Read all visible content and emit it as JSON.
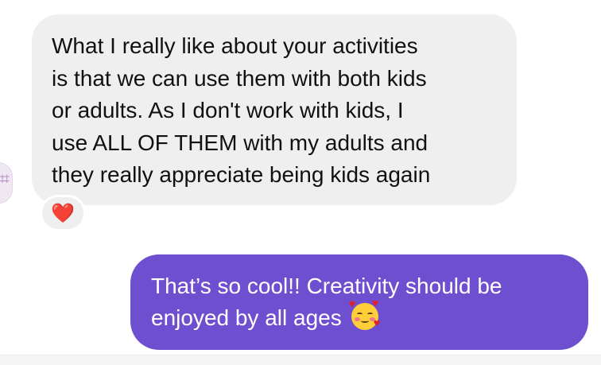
{
  "incoming_message": {
    "lines": [
      "What I really like about your activities",
      "is that we can use them with both kids",
      "or adults. As I don't work with kids, I",
      "use ALL OF THEM with my adults and",
      "they really appreciate being kids again"
    ],
    "reaction": "❤️"
  },
  "outgoing_message": {
    "lines": [
      "That’s so cool!! Creativity should be",
      "enjoyed by all ages"
    ],
    "emoji": "smiling-face-with-hearts"
  },
  "colors": {
    "incoming_bubble": "#efefef",
    "outgoing_bubble": "#6e4fd0",
    "reaction_heart": "#e0202b"
  }
}
